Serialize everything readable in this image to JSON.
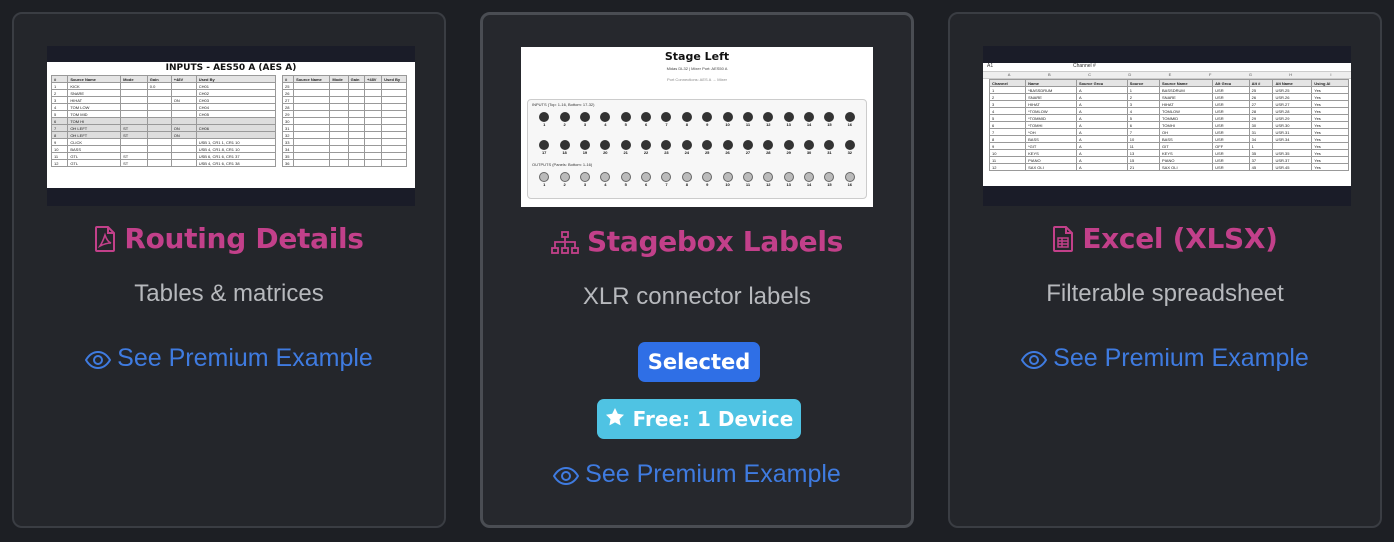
{
  "cards": [
    {
      "title": "Routing Details",
      "subtitle": "Tables & matrices",
      "link": "See Premium Example",
      "icon": "pdf-file-icon",
      "thumb": {
        "title": "INPUTS - AES50 A (AES A)",
        "headers": [
          "#",
          "Source Name",
          "Mode",
          "Gain",
          "+48V",
          "Used By"
        ],
        "right_headers": [
          "#",
          "Source Name",
          "Mode",
          "Gain",
          "+48V",
          "Used By"
        ],
        "rows": [
          [
            "1",
            "KICK",
            "",
            "0.0",
            "",
            "CH01"
          ],
          [
            "2",
            "SNARE",
            "",
            "",
            "",
            "CH02"
          ],
          [
            "3",
            "HIHAT",
            "",
            "",
            "ON",
            "CH03"
          ],
          [
            "4",
            "TOM LOW",
            "",
            "",
            "",
            "CH04"
          ],
          [
            "5",
            "TOM MID",
            "",
            "",
            "",
            "CH05"
          ],
          [
            "6",
            "TOM HI",
            "",
            "",
            "",
            ""
          ],
          [
            "7",
            "OH LEFT",
            "ST",
            "",
            "ON",
            "CH06"
          ],
          [
            "8",
            "OH LEFT",
            "ST",
            "",
            "ON",
            ""
          ],
          [
            "9",
            "CLICK",
            "",
            "",
            "",
            "USB 1, CR1 1, CR1 10"
          ],
          [
            "10",
            "BASS",
            "",
            "",
            "",
            "USB 4, CR1 8, CR1 10"
          ],
          [
            "11",
            "GTL",
            "ST",
            "",
            "",
            "USB 6, CR1 6, CR1 37"
          ],
          [
            "12",
            "GTL",
            "ST",
            "",
            "",
            "USB 4, CR1 6, CR1 38"
          ]
        ],
        "right_nums": [
          "25",
          "26",
          "27",
          "28",
          "29",
          "30",
          "31",
          "32",
          "33",
          "34",
          "35",
          "36"
        ]
      }
    },
    {
      "title": "Stagebox Labels",
      "subtitle": "XLR connector labels",
      "link": "See Premium Example",
      "icon": "sitemap-icon",
      "badge_selected": "Selected",
      "badge_free": "Free: 1 Device",
      "thumb": {
        "title": "Stage Left",
        "sub": "Midas DL32 | Mixer Port: AES50 A",
        "sub2": "Port Connections: AES A → Mixer",
        "inputs_header": "INPUTS (Top: 1-16, Bottom: 17-32)",
        "outputs_header": "OUTPUTS (Panels: Bottom: 1-16)",
        "row1": [
          "1",
          "2",
          "3",
          "4",
          "5",
          "6",
          "7",
          "8",
          "9",
          "10",
          "11",
          "12",
          "13",
          "14",
          "15",
          "16"
        ],
        "row2": [
          "17",
          "18",
          "19",
          "20",
          "21",
          "22",
          "23",
          "24",
          "25",
          "26",
          "27",
          "28",
          "29",
          "30",
          "31",
          "32"
        ],
        "row3": [
          "1",
          "2",
          "3",
          "4",
          "5",
          "6",
          "7",
          "8",
          "9",
          "10",
          "11",
          "12",
          "13",
          "14",
          "15",
          "16"
        ]
      }
    },
    {
      "title": "Excel (XLSX)",
      "subtitle": "Filterable spreadsheet",
      "link": "See Premium Example",
      "icon": "spreadsheet-icon",
      "thumb": {
        "cell_ref": "A1",
        "formula": "Channel #",
        "col_letters": [
          "A",
          "B",
          "C",
          "D",
          "E",
          "F",
          "G",
          "H",
          "I"
        ],
        "headers": [
          "Channel",
          "Name",
          "Source Grou",
          "Source",
          "Source Name",
          "Alt Grou",
          "Alt #",
          "Alt Name",
          "Using Al"
        ],
        "rows": [
          [
            "1",
            "*BASSDRUM",
            "A",
            "1",
            "BASSDRUM",
            "USR",
            "25",
            "USR.25",
            "Yes"
          ],
          [
            "2",
            "SNARE",
            "A",
            "2",
            "SNARE",
            "USR",
            "26",
            "USR.26",
            "Yes"
          ],
          [
            "3",
            "HIHAT",
            "A",
            "3",
            "HIHAT",
            "USR",
            "27",
            "USR.27",
            "Yes"
          ],
          [
            "4",
            "*TOMLOW",
            "A",
            "4",
            "TOMLOW",
            "USR",
            "28",
            "USR.28",
            "Yes"
          ],
          [
            "5",
            "*TOMMID",
            "A",
            "5",
            "TOMMID",
            "USR",
            "29",
            "USR.29",
            "Yes"
          ],
          [
            "6",
            "*TOMHI",
            "A",
            "6",
            "TOMHI",
            "USR",
            "30",
            "USR.30",
            "Yes"
          ],
          [
            "7",
            "*OH",
            "A",
            "7",
            "OH",
            "USR",
            "31",
            "USR.31",
            "Yes"
          ],
          [
            "8",
            "BASS",
            "A",
            "10",
            "BASS",
            "USR",
            "34",
            "USR.34",
            "Yes"
          ],
          [
            "9",
            "*GIT",
            "A",
            "11",
            "GIT",
            "OFF",
            "1",
            "",
            "Yes"
          ],
          [
            "10",
            "KEYS",
            "A",
            "13",
            "KEYS",
            "USR",
            "35",
            "USR.35",
            "Yes"
          ],
          [
            "11",
            "PIANO",
            "A",
            "15",
            "PIANO",
            "USR",
            "37",
            "USR.37",
            "Yes"
          ],
          [
            "12",
            "SAX OLI",
            "A",
            "21",
            "SAX OLI",
            "USR",
            "45",
            "USR.45",
            "Yes"
          ]
        ]
      }
    }
  ],
  "colors": {
    "accent_title": "#c2408a",
    "link": "#3f7be0",
    "selected": "#2f6fe6",
    "free": "#4fc3e3"
  }
}
